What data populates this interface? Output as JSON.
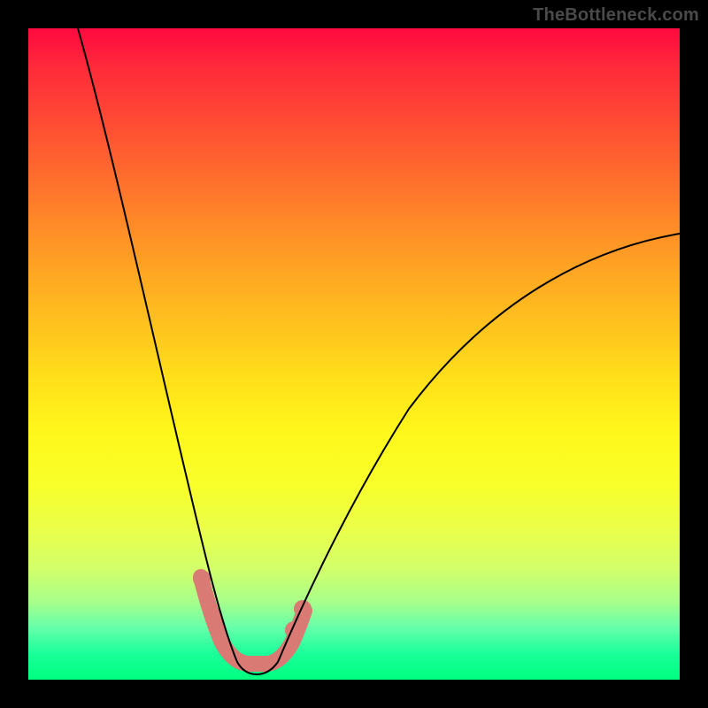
{
  "watermark": "TheBottleneck.com",
  "colors": {
    "gradient_top": "#ff0a40",
    "gradient_mid": "#fff71b",
    "gradient_bottom": "#00ff7f",
    "curve": "#000000",
    "band": "#d97a74",
    "frame": "#000000"
  },
  "chart_data": {
    "type": "line",
    "title": "",
    "xlabel": "",
    "ylabel": "",
    "xlim": [
      0,
      100
    ],
    "ylim": [
      0,
      100
    ],
    "grid": false,
    "legend": false,
    "note": "Bottleneck curve: y ≈ 100 near x=0, drops to ~0 at x≈30–36, rises toward ~68 at x=100. Axis values in percent (estimated from gradient and curve shape; no tick labels visible).",
    "series": [
      {
        "name": "left-branch",
        "x": [
          0,
          4,
          8,
          12,
          16,
          20,
          24,
          26,
          28,
          30
        ],
        "values": [
          100,
          88,
          76,
          63,
          50,
          36,
          22,
          14,
          7,
          1
        ]
      },
      {
        "name": "trough",
        "x": [
          30,
          32,
          34,
          36
        ],
        "values": [
          1,
          0,
          0,
          1
        ]
      },
      {
        "name": "right-branch",
        "x": [
          36,
          40,
          46,
          52,
          60,
          70,
          80,
          90,
          100
        ],
        "values": [
          1,
          8,
          18,
          28,
          39,
          50,
          58,
          64,
          68
        ]
      },
      {
        "name": "optimal-band",
        "note": "Thick salmon segment marking the low-bottleneck zone near the trough",
        "x": [
          26,
          27,
          28,
          29,
          30,
          32,
          34,
          36,
          37,
          38,
          39,
          40
        ],
        "values": [
          14,
          11,
          8,
          5,
          2,
          0.5,
          0.5,
          2,
          4,
          6,
          8,
          10
        ]
      }
    ]
  }
}
